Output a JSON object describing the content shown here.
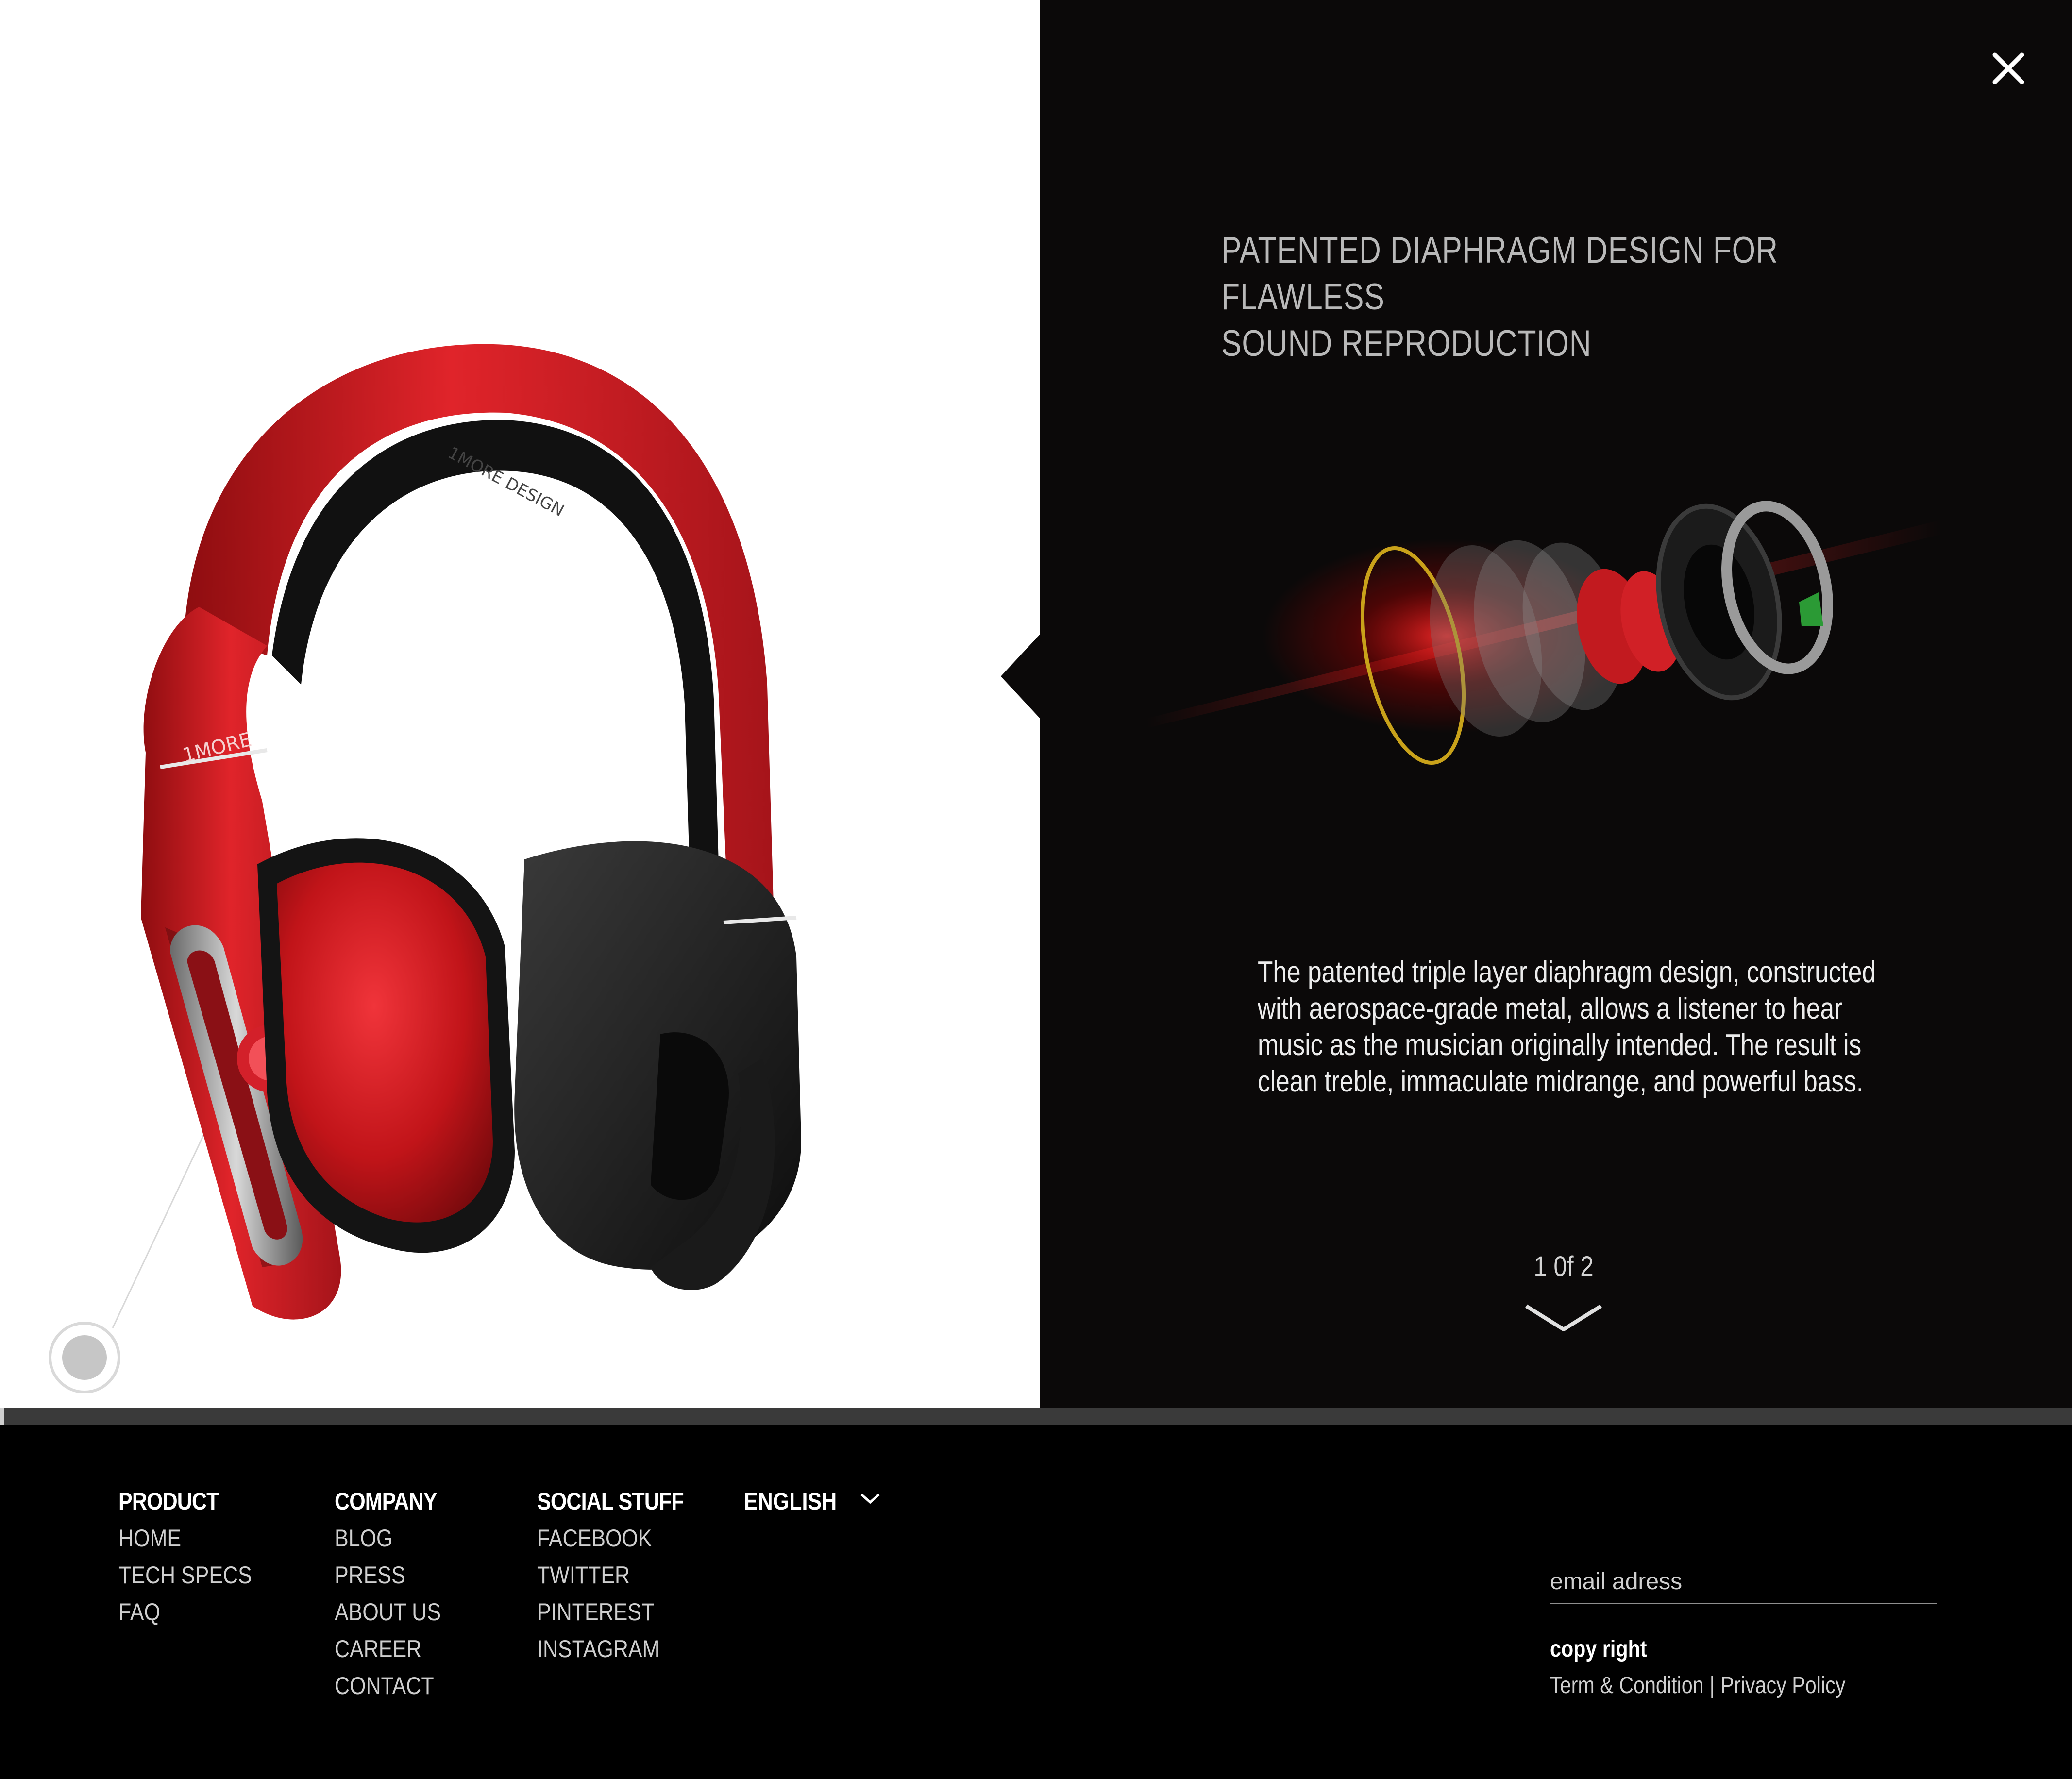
{
  "feature": {
    "title_line1": "PATENTED DIAPHRAGM DESIGN FOR FLAWLESS",
    "title_line2": "SOUND REPRODUCTION",
    "description": "The patented triple layer diaphragm design, constructed with aerospace-grade metal, allows a listener to hear music as the musician originally intended. The result is clean treble, immaculate midrange, and powerful bass.",
    "pager": "1 0f 2"
  },
  "icons": {
    "close": "close-icon",
    "next": "chevron-down-icon",
    "language": "chevron-down-icon",
    "hotspot": "hotspot-dot-icon"
  },
  "footer": {
    "product": {
      "heading": "PRODUCT",
      "items": [
        "HOME",
        "TECH SPECS",
        "FAQ"
      ]
    },
    "company": {
      "heading": "COMPANY",
      "items": [
        "BLOG",
        "PRESS",
        "ABOUT US",
        "CAREER",
        "CONTACT"
      ]
    },
    "social": {
      "heading": "SOCIAL STUFF",
      "items": [
        "FACEBOOK",
        "TWITTER",
        "PINTEREST",
        "INSTAGRAM"
      ]
    },
    "language": "ENGLISH",
    "email_placeholder": "email adress",
    "copyright": "copy right",
    "terms": "Term & Condition",
    "separator": "|",
    "privacy": "Privacy Policy"
  },
  "colors": {
    "dark_panel": "#0b0909",
    "footer_bg": "#000000",
    "accent_red": "#d4141c",
    "divider": "#3a3a3a"
  }
}
